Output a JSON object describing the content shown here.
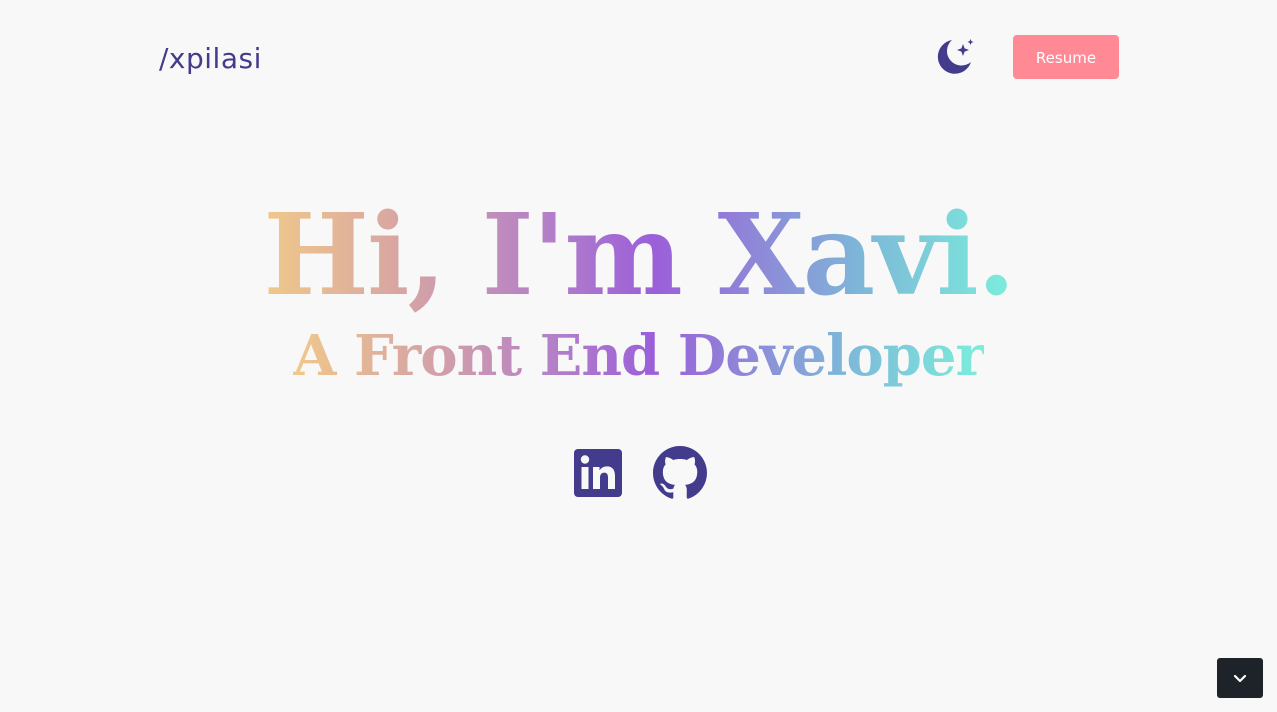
{
  "header": {
    "logo_text": "/xpilasi",
    "theme_toggle_icon": "moon-stars-icon",
    "resume_label": "Resume"
  },
  "hero": {
    "headline": "Hi, I'm Xavi.",
    "subheadline": "A Front End Developer"
  },
  "socials": [
    {
      "icon": "linkedin-icon"
    },
    {
      "icon": "github-icon"
    }
  ],
  "scroll_button": {
    "icon": "chevron-down-icon"
  },
  "colors": {
    "background": "#f8f8f8",
    "brand": "#433b8c",
    "resume_button": "#ff8a96",
    "scroll_button": "#1e2329",
    "gradient": [
      "#f0c98a",
      "#d8a6a2",
      "#b37fc9",
      "#9b5fd9",
      "#8c8fd8",
      "#7db8d8",
      "#7ceedb"
    ]
  }
}
